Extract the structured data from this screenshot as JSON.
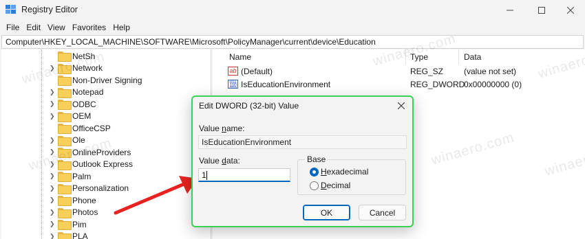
{
  "window": {
    "title": "Registry Editor"
  },
  "menu": [
    "File",
    "Edit",
    "View",
    "Favorites",
    "Help"
  ],
  "address": "Computer\\HKEY_LOCAL_MACHINE\\SOFTWARE\\Microsoft\\PolicyManager\\current\\device\\Education",
  "tree": {
    "items": [
      {
        "label": "NetSh",
        "expander": false
      },
      {
        "label": "Network",
        "expander": true
      },
      {
        "label": "Non-Driver Signing",
        "expander": false
      },
      {
        "label": "Notepad",
        "expander": true
      },
      {
        "label": "ODBC",
        "expander": true
      },
      {
        "label": "OEM",
        "expander": true
      },
      {
        "label": "OfficeCSP",
        "expander": false
      },
      {
        "label": "Ole",
        "expander": true
      },
      {
        "label": "OnlineProviders",
        "expander": true
      },
      {
        "label": "Outlook Express",
        "expander": true
      },
      {
        "label": "Palm",
        "expander": true
      },
      {
        "label": "Personalization",
        "expander": true
      },
      {
        "label": "Phone",
        "expander": true
      },
      {
        "label": "Photos",
        "expander": true
      },
      {
        "label": "Pim",
        "expander": true
      },
      {
        "label": "PLA",
        "expander": true
      }
    ]
  },
  "list": {
    "columns": {
      "name": "Name",
      "type": "Type",
      "data": "Data"
    },
    "rows": [
      {
        "icon": "string-value-icon",
        "name": "(Default)",
        "type": "REG_SZ",
        "data": "(value not set)"
      },
      {
        "icon": "binary-value-icon",
        "name": "IsEducationEnvironment",
        "type": "REG_DWORD",
        "data": "0x00000000 (0)"
      }
    ]
  },
  "dialog": {
    "title": "Edit DWORD (32-bit) Value",
    "value_name_label": "Value name:",
    "value_name": "IsEducationEnvironment",
    "value_data_label": "Value data:",
    "value_data": "1",
    "base_label": "Base",
    "hex_label": "Hexadecimal",
    "dec_label": "Decimal",
    "base_selected": "Hexadecimal",
    "ok_label": "OK",
    "cancel_label": "Cancel"
  },
  "watermark": "winaero.com",
  "colors": {
    "accent": "#0067c0",
    "highlight_border": "#39d353",
    "arrow": "#e8231f"
  }
}
